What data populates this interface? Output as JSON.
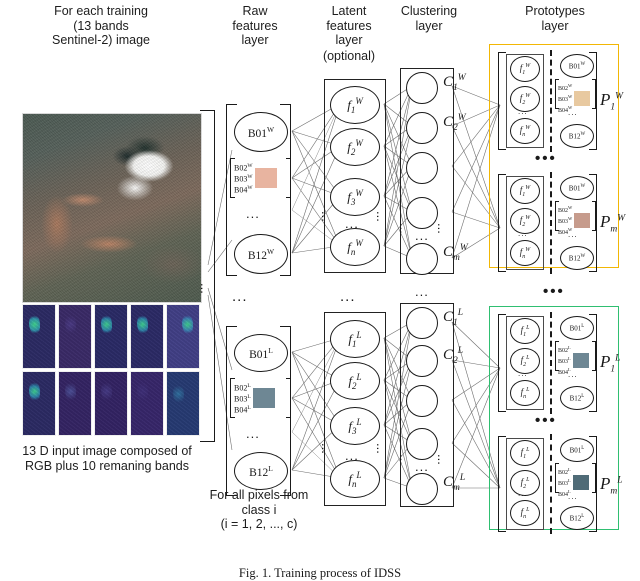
{
  "figure": {
    "caption": "Fig. 1. Training process of IDSS",
    "colors": {
      "prototype_group_w": "#f2b705",
      "prototype_group_l": "#2fbf71",
      "swatch_w": "#e8b4a0",
      "swatch_w2": "#c69b8c",
      "swatch_l": "#6e8794",
      "edge": "#6e6e6e"
    }
  },
  "headers": {
    "input": [
      "For each training",
      "(13 bands",
      "Sentinel-2) image"
    ],
    "raw": [
      "Raw",
      "features",
      "layer"
    ],
    "latent": [
      "Latent",
      "features",
      "layer"
    ],
    "latent_optional": "(optional)",
    "clustering": [
      "Clustering",
      "layer"
    ],
    "prototypes": [
      "Prototypes",
      "layer"
    ]
  },
  "input_block": {
    "caption": [
      "13 D input image composed of",
      "RGB plus 10 remaning bands"
    ],
    "rgb_image_name": "sentinel-2-rgb-composite",
    "band_thumbnails": [
      {
        "name": "band-thumb-1",
        "intensity": "high"
      },
      {
        "name": "band-thumb-2",
        "intensity": "low"
      },
      {
        "name": "band-thumb-3",
        "intensity": "medium"
      },
      {
        "name": "band-thumb-4",
        "intensity": "medium"
      },
      {
        "name": "band-thumb-5",
        "intensity": "low"
      },
      {
        "name": "band-thumb-6",
        "intensity": "medium"
      },
      {
        "name": "band-thumb-7",
        "intensity": "low"
      },
      {
        "name": "band-thumb-8",
        "intensity": "low"
      },
      {
        "name": "band-thumb-9",
        "intensity": "low"
      },
      {
        "name": "band-thumb-10",
        "intensity": "medium"
      }
    ]
  },
  "class_note": [
    "For all pixels from",
    "class i",
    "(i = 1, 2, ..., c)"
  ],
  "branches": {
    "w": {
      "superscript": "W",
      "raw": {
        "first": "B01",
        "last": "B12",
        "mid_bands": [
          "B02",
          "B03",
          "B04"
        ],
        "swatch": "#e8b4a0"
      },
      "latent": {
        "nodes": [
          "f1",
          "f2",
          "f3",
          "fn"
        ],
        "subs": [
          "1",
          "2",
          "3",
          "n"
        ]
      },
      "clustering": {
        "labels": [
          "C1",
          "C2",
          "Cm"
        ],
        "subs": [
          "1",
          "2",
          "m"
        ],
        "node_count": 5
      },
      "prototypes": [
        {
          "label": "P1",
          "sub": "1",
          "latent": [
            "f1",
            "f2",
            "fn"
          ],
          "latent_subs": [
            "1",
            "2",
            "n"
          ],
          "raw_first": "B01",
          "raw_last": "B12",
          "mid_bands": [
            "B02",
            "B03",
            "B04"
          ],
          "swatch": "#e8b4a0"
        },
        {
          "label": "Pm",
          "sub": "m",
          "latent": [
            "f1",
            "f2",
            "fn"
          ],
          "latent_subs": [
            "1",
            "2",
            "n"
          ],
          "raw_first": "B01",
          "raw_last": "B12",
          "mid_bands": [
            "B02",
            "B03",
            "B04"
          ],
          "swatch": "#c69b8c"
        }
      ]
    },
    "l": {
      "superscript": "L",
      "raw": {
        "first": "B01",
        "last": "B12",
        "mid_bands": [
          "B02",
          "B03",
          "B04"
        ],
        "swatch": "#6e8794"
      },
      "latent": {
        "nodes": [
          "f1",
          "f2",
          "f3",
          "fn"
        ],
        "subs": [
          "1",
          "2",
          "3",
          "n"
        ]
      },
      "clustering": {
        "labels": [
          "C1",
          "C2",
          "Cm"
        ],
        "subs": [
          "1",
          "2",
          "m"
        ],
        "node_count": 5
      },
      "prototypes": [
        {
          "label": "P1",
          "sub": "1",
          "latent": [
            "f1",
            "f2",
            "fn"
          ],
          "latent_subs": [
            "1",
            "2",
            "n"
          ],
          "raw_first": "B01",
          "raw_last": "B12",
          "mid_bands": [
            "B02",
            "B03",
            "B04"
          ],
          "swatch": "#6e8794"
        },
        {
          "label": "Pm",
          "sub": "m",
          "latent": [
            "f1",
            "f2",
            "fn"
          ],
          "latent_subs": [
            "1",
            "2",
            "n"
          ],
          "raw_first": "B01",
          "raw_last": "B12",
          "mid_bands": [
            "B02",
            "B03",
            "B04"
          ],
          "swatch": "#4f6b77"
        }
      ]
    }
  },
  "ellipsis": {
    "horizontal": "...",
    "vertical": "...",
    "bold": "•••"
  }
}
